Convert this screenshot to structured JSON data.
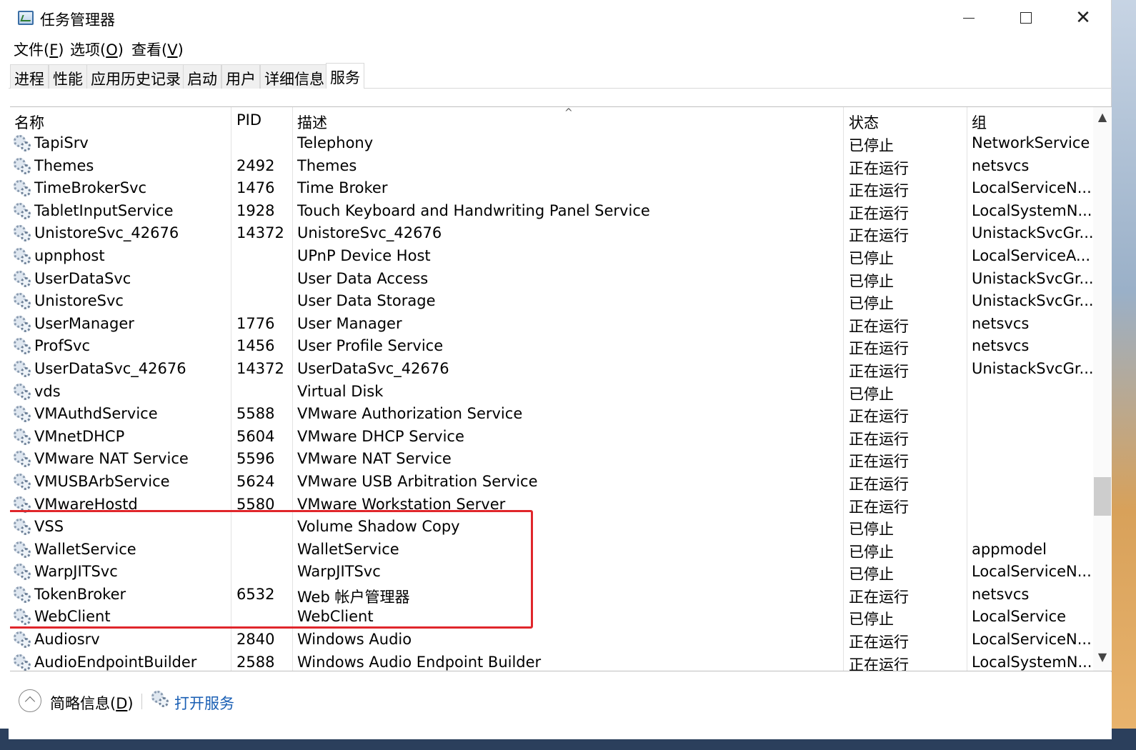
{
  "window": {
    "title": "任务管理器",
    "minimize_glyph": "—",
    "maximize_glyph": "☐",
    "close_glyph": "✕"
  },
  "menu": [
    {
      "label": "文件(",
      "key": "F",
      "suffix": ")"
    },
    {
      "label": "选项(",
      "key": "O",
      "suffix": ")"
    },
    {
      "label": "查看(",
      "key": "V",
      "suffix": ")"
    }
  ],
  "tabs": [
    "进程",
    "性能",
    "应用历史记录",
    "启动",
    "用户",
    "详细信息",
    "服务"
  ],
  "active_tab": "服务",
  "columns": {
    "name": "名称",
    "pid": "PID",
    "desc": "描述",
    "status": "状态",
    "group": "组",
    "sort_indicator": "^"
  },
  "services": [
    {
      "name": "TapiSrv",
      "pid": "",
      "desc": "Telephony",
      "status": "已停止",
      "group": "NetworkService"
    },
    {
      "name": "Themes",
      "pid": "2492",
      "desc": "Themes",
      "status": "正在运行",
      "group": "netsvcs"
    },
    {
      "name": "TimeBrokerSvc",
      "pid": "1476",
      "desc": "Time Broker",
      "status": "正在运行",
      "group": "LocalServiceN..."
    },
    {
      "name": "TabletInputService",
      "pid": "1928",
      "desc": "Touch Keyboard and Handwriting Panel Service",
      "status": "正在运行",
      "group": "LocalSystemN..."
    },
    {
      "name": "UnistoreSvc_42676",
      "pid": "14372",
      "desc": "UnistoreSvc_42676",
      "status": "正在运行",
      "group": "UnistackSvcGr..."
    },
    {
      "name": "upnphost",
      "pid": "",
      "desc": "UPnP Device Host",
      "status": "已停止",
      "group": "LocalServiceA..."
    },
    {
      "name": "UserDataSvc",
      "pid": "",
      "desc": "User Data Access",
      "status": "已停止",
      "group": "UnistackSvcGr..."
    },
    {
      "name": "UnistoreSvc",
      "pid": "",
      "desc": "User Data Storage",
      "status": "已停止",
      "group": "UnistackSvcGr..."
    },
    {
      "name": "UserManager",
      "pid": "1776",
      "desc": "User Manager",
      "status": "正在运行",
      "group": "netsvcs"
    },
    {
      "name": "ProfSvc",
      "pid": "1456",
      "desc": "User Profile Service",
      "status": "正在运行",
      "group": "netsvcs"
    },
    {
      "name": "UserDataSvc_42676",
      "pid": "14372",
      "desc": "UserDataSvc_42676",
      "status": "正在运行",
      "group": "UnistackSvcGr..."
    },
    {
      "name": "vds",
      "pid": "",
      "desc": "Virtual Disk",
      "status": "已停止",
      "group": ""
    },
    {
      "name": "VMAuthdService",
      "pid": "5588",
      "desc": "VMware Authorization Service",
      "status": "正在运行",
      "group": ""
    },
    {
      "name": "VMnetDHCP",
      "pid": "5604",
      "desc": "VMware DHCP Service",
      "status": "正在运行",
      "group": ""
    },
    {
      "name": "VMware NAT Service",
      "pid": "5596",
      "desc": "VMware NAT Service",
      "status": "正在运行",
      "group": ""
    },
    {
      "name": "VMUSBArbService",
      "pid": "5624",
      "desc": "VMware USB Arbitration Service",
      "status": "正在运行",
      "group": ""
    },
    {
      "name": "VMwareHostd",
      "pid": "5580",
      "desc": "VMware Workstation Server",
      "status": "正在运行",
      "group": ""
    },
    {
      "name": "VSS",
      "pid": "",
      "desc": "Volume Shadow Copy",
      "status": "已停止",
      "group": ""
    },
    {
      "name": "WalletService",
      "pid": "",
      "desc": "WalletService",
      "status": "已停止",
      "group": "appmodel"
    },
    {
      "name": "WarpJITSvc",
      "pid": "",
      "desc": "WarpJITSvc",
      "status": "已停止",
      "group": "LocalServiceN..."
    },
    {
      "name": "TokenBroker",
      "pid": "6532",
      "desc": "Web 帐户管理器",
      "status": "正在运行",
      "group": "netsvcs"
    },
    {
      "name": "WebClient",
      "pid": "",
      "desc": "WebClient",
      "status": "已停止",
      "group": "LocalService"
    },
    {
      "name": "Audiosrv",
      "pid": "2840",
      "desc": "Windows Audio",
      "status": "正在运行",
      "group": "LocalServiceN..."
    },
    {
      "name": "AudioEndpointBuilder",
      "pid": "2588",
      "desc": "Windows Audio Endpoint Builder",
      "status": "正在运行",
      "group": "LocalSystemN..."
    }
  ],
  "footer": {
    "less_details_label": "简略信息(",
    "less_details_key": "D",
    "less_details_suffix": ")",
    "open_services_link": "打开服务"
  },
  "colors": {
    "highlight_border": "#e0262b",
    "link": "#1a5fb4"
  },
  "icons": {
    "service_row": "gears-icon",
    "app": "task-manager-icon",
    "footer_collapse": "chevron-up-circle-icon",
    "footer_open_services": "gears-icon"
  }
}
